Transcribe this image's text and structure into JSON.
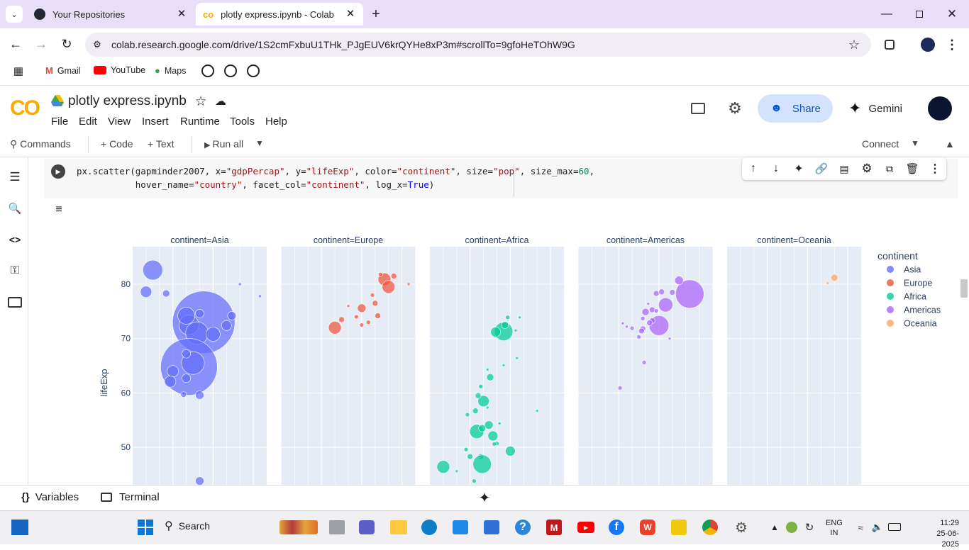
{
  "browser": {
    "tabs": [
      {
        "title": "Your Repositories",
        "icon": "github-icon",
        "active": false
      },
      {
        "title": "plotly express.ipynb - Colab",
        "icon": "colab-icon",
        "active": true
      }
    ],
    "url": "colab.research.google.com/drive/1S2cmFxbuU1THk_PJgEUV6krQYHe8xP3m#scrollTo=9gfoHeTOhW9G",
    "bookmarks": [
      "Gmail",
      "YouTube",
      "Maps"
    ]
  },
  "colab": {
    "filename": "plotly express.ipynb",
    "menus": [
      "File",
      "Edit",
      "View",
      "Insert",
      "Runtime",
      "Tools",
      "Help"
    ],
    "share_label": "Share",
    "gemini_label": "Gemini",
    "commands_label": "Commands",
    "code_label": "+ Code",
    "text_label": "+ Text",
    "run_all_label": "Run all",
    "connect_label": "Connect",
    "code_line1": [
      {
        "t": "px.scatter(gapminder2007, x=",
        "c": ""
      },
      {
        "t": "\"gdpPercap\"",
        "c": "str"
      },
      {
        "t": ", y=",
        "c": ""
      },
      {
        "t": "\"lifeExp\"",
        "c": "str"
      },
      {
        "t": ", color=",
        "c": ""
      },
      {
        "t": "\"continent\"",
        "c": "str"
      },
      {
        "t": ", size=",
        "c": ""
      },
      {
        "t": "\"pop\"",
        "c": "str"
      },
      {
        "t": ", size_max=",
        "c": ""
      },
      {
        "t": "60",
        "c": "num"
      },
      {
        "t": ",",
        "c": ""
      }
    ],
    "code_line2": [
      {
        "t": "           hover_name=",
        "c": ""
      },
      {
        "t": "\"country\"",
        "c": "str"
      },
      {
        "t": ", facet_col=",
        "c": ""
      },
      {
        "t": "\"continent\"",
        "c": "str"
      },
      {
        "t": ", log_x=",
        "c": ""
      },
      {
        "t": "True",
        "c": "kw"
      },
      {
        "t": ")",
        "c": ""
      }
    ],
    "variables_label": "Variables",
    "terminal_label": "Terminal"
  },
  "chart_data": {
    "type": "scatter",
    "facets": [
      "continent=Asia",
      "continent=Europe",
      "continent=Africa",
      "continent=Americas",
      "continent=Oceania"
    ],
    "ylabel": "lifeExp",
    "ylim": [
      41,
      87
    ],
    "yticks": [
      50,
      60,
      70,
      80
    ],
    "log_x": true,
    "legend_title": "continent",
    "series": [
      {
        "name": "Asia",
        "color": "#636efa",
        "points": [
          [
            0.15,
            82.6,
            14
          ],
          [
            0.1,
            78.6,
            8
          ],
          [
            0.25,
            78.3,
            5
          ],
          [
            0.8,
            80,
            2
          ],
          [
            0.95,
            77.8,
            2
          ],
          [
            0.53,
            73,
            44
          ],
          [
            0.42,
            72.5,
            14
          ],
          [
            0.48,
            71,
            16
          ],
          [
            0.6,
            70.8,
            10
          ],
          [
            0.4,
            74.2,
            12
          ],
          [
            0.5,
            74.6,
            6
          ],
          [
            0.74,
            74.2,
            6
          ],
          [
            0.7,
            72.4,
            7
          ],
          [
            0.42,
            64.8,
            40
          ],
          [
            0.45,
            65.5,
            16
          ],
          [
            0.3,
            64,
            8
          ],
          [
            0.28,
            62.1,
            8
          ],
          [
            0.4,
            67.2,
            6
          ],
          [
            0.4,
            62.7,
            6
          ],
          [
            0.5,
            59.6,
            6
          ],
          [
            0.38,
            59.7,
            4
          ],
          [
            0.5,
            43.8,
            6
          ]
        ]
      },
      {
        "name": "Europe",
        "color": "#ef553b",
        "points": [
          [
            0.77,
            80.9,
            9
          ],
          [
            0.8,
            79.5,
            9
          ],
          [
            0.84,
            81.5,
            4
          ],
          [
            0.74,
            81.8,
            3
          ],
          [
            0.68,
            78,
            3
          ],
          [
            0.7,
            76.5,
            4
          ],
          [
            0.6,
            75.6,
            6
          ],
          [
            0.72,
            74.2,
            4
          ],
          [
            0.56,
            74,
            3
          ],
          [
            0.5,
            76,
            2
          ],
          [
            0.65,
            73,
            3
          ],
          [
            0.6,
            72.5,
            3
          ],
          [
            0.4,
            72,
            9
          ],
          [
            0.45,
            73.5,
            4
          ],
          [
            0.95,
            80,
            2
          ]
        ]
      },
      {
        "name": "Africa",
        "color": "#00cc96",
        "points": [
          [
            0.55,
            71.3,
            13
          ],
          [
            0.49,
            71.2,
            7
          ],
          [
            0.56,
            72.5,
            5
          ],
          [
            0.58,
            73.9,
            3
          ],
          [
            0.64,
            71.5,
            2
          ],
          [
            0.67,
            73.9,
            2
          ],
          [
            0.4,
            58.5,
            8
          ],
          [
            0.35,
            52.9,
            10
          ],
          [
            0.47,
            52.1,
            7
          ],
          [
            0.44,
            54.1,
            6
          ],
          [
            0.34,
            56.7,
            4
          ],
          [
            0.3,
            48.3,
            4
          ],
          [
            0.38,
            48.3,
            4
          ],
          [
            0.39,
            53.5,
            5
          ],
          [
            0.45,
            62.9,
            5
          ],
          [
            0.43,
            64.3,
            2
          ],
          [
            0.36,
            59.5,
            4
          ],
          [
            0.27,
            49.6,
            3
          ],
          [
            0.1,
            46.4,
            9
          ],
          [
            0.39,
            46.9,
            13
          ],
          [
            0.6,
            49.3,
            7
          ],
          [
            0.8,
            56.7,
            2
          ],
          [
            0.5,
            50.7,
            3
          ],
          [
            0.52,
            54.4,
            2
          ],
          [
            0.43,
            57.3,
            2
          ],
          [
            0.3,
            42.6,
            3
          ],
          [
            0.55,
            65.1,
            2
          ],
          [
            0.28,
            56,
            3
          ],
          [
            0.2,
            45.6,
            2
          ],
          [
            0.33,
            43.8,
            3
          ],
          [
            0.38,
            61.2,
            3
          ],
          [
            0.48,
            50.6,
            3
          ],
          [
            0.65,
            66.4,
            2
          ]
        ]
      },
      {
        "name": "Americas",
        "color": "#ab63fa",
        "points": [
          [
            0.83,
            78.2,
            20
          ],
          [
            0.6,
            72.4,
            14
          ],
          [
            0.65,
            76.2,
            10
          ],
          [
            0.75,
            80.7,
            6
          ],
          [
            0.58,
            78.3,
            4
          ],
          [
            0.62,
            78.6,
            4
          ],
          [
            0.7,
            78.5,
            4
          ],
          [
            0.5,
            74.9,
            5
          ],
          [
            0.55,
            73.3,
            4
          ],
          [
            0.53,
            72.9,
            4
          ],
          [
            0.48,
            71.8,
            4
          ],
          [
            0.47,
            71.4,
            4
          ],
          [
            0.55,
            75.3,
            4
          ],
          [
            0.45,
            70.3,
            3
          ],
          [
            0.33,
            72.8,
            2
          ],
          [
            0.36,
            72.2,
            2
          ],
          [
            0.4,
            71.9,
            3
          ],
          [
            0.48,
            73.7,
            3
          ],
          [
            0.52,
            76.4,
            2
          ],
          [
            0.58,
            75.1,
            3
          ],
          [
            0.68,
            70,
            2
          ],
          [
            0.49,
            65.6,
            3
          ],
          [
            0.31,
            60.9,
            3
          ]
        ]
      },
      {
        "name": "Oceania",
        "color": "#ffa15a",
        "points": [
          [
            0.8,
            81.2,
            5
          ],
          [
            0.75,
            80.2,
            2
          ]
        ]
      }
    ]
  }
}
